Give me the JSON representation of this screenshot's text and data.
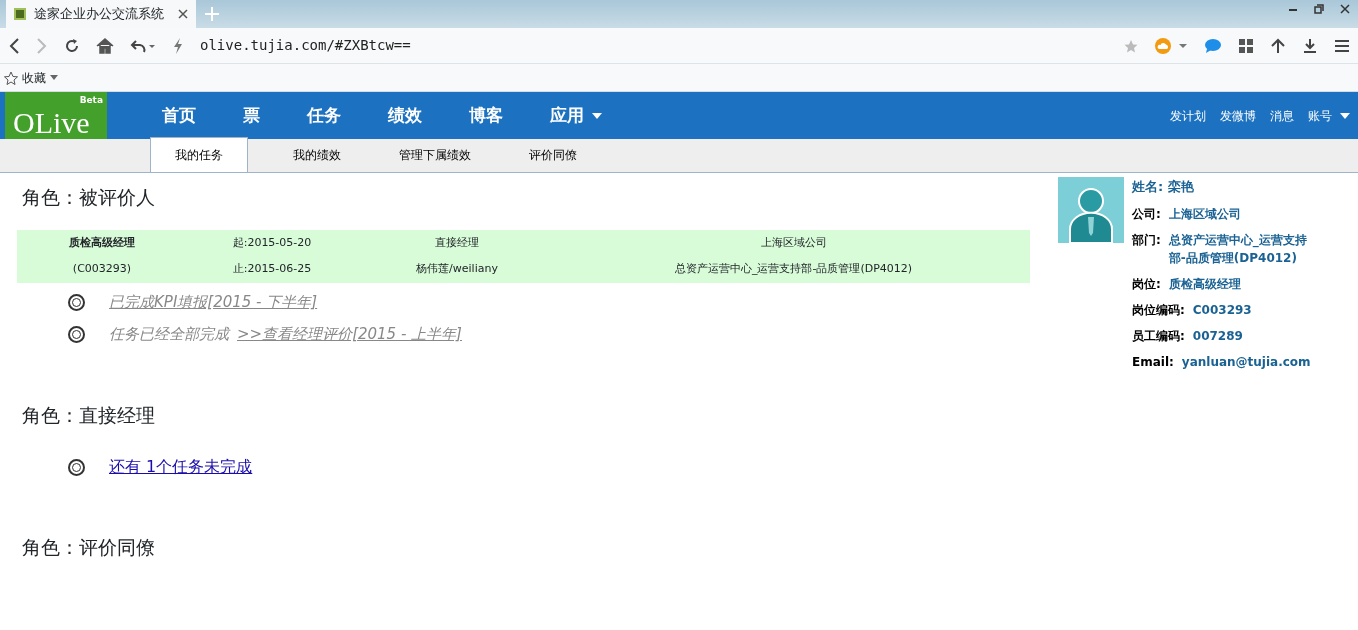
{
  "browser": {
    "tab_title": "途家企业办公交流系统",
    "url": "olive.tujia.com/#ZXBtcw==",
    "bookmark": "收藏"
  },
  "navbar": {
    "logo": "OLive",
    "logo_badge": "Beta",
    "items": [
      {
        "label": "首页",
        "caret": false
      },
      {
        "label": "票",
        "caret": false
      },
      {
        "label": "任务",
        "caret": false
      },
      {
        "label": "绩效",
        "caret": false
      },
      {
        "label": "博客",
        "caret": false
      },
      {
        "label": "应用",
        "caret": true
      }
    ],
    "right_items": [
      {
        "label": "发计划",
        "caret": false
      },
      {
        "label": "发微博",
        "caret": false
      },
      {
        "label": "消息",
        "caret": false
      },
      {
        "label": "账号",
        "caret": true
      }
    ]
  },
  "subnav": [
    {
      "label": "我的任务",
      "selected": true
    },
    {
      "label": "我的绩效",
      "selected": false
    },
    {
      "label": "管理下属绩效",
      "selected": false
    },
    {
      "label": "评价同僚",
      "selected": false
    }
  ],
  "roles": [
    {
      "title": "角色：被评价人",
      "info_rows": [
        [
          "质检高级经理",
          "起:2015-05-20",
          "直接经理",
          "上海区域公司"
        ],
        [
          "(C003293)",
          "止:2015-06-25",
          "杨伟莲/weiliany",
          "总资产运营中心_运营支持部-品质管理(DP4012)"
        ]
      ],
      "tasks": [
        {
          "link": " 已完成KPI填报[2015 - 下半年]",
          "done": true
        },
        {
          "text": "任务已经全部完成",
          "link": " >>查看经理评价[2015 - 上半年]",
          "done": true
        }
      ]
    },
    {
      "title": "角色：直接经理",
      "tasks": [
        {
          "link": " 还有 1个任务未完成",
          "done": false
        }
      ]
    },
    {
      "title": "角色：评价同僚"
    }
  ],
  "profile": {
    "name_label": "姓名:",
    "name": "栾艳",
    "fields": [
      {
        "label": "公司:",
        "value": "上海区域公司"
      },
      {
        "label": "部门:",
        "value": "总资产运营中心_运营支持部-品质管理(DP4012)"
      },
      {
        "label": "岗位:",
        "value": "质检高级经理"
      },
      {
        "label": "岗位编码:",
        "value": "C003293"
      },
      {
        "label": "员工编码:",
        "value": "007289"
      },
      {
        "label": "Email:",
        "value": "yanluan@tujia.com"
      }
    ]
  }
}
